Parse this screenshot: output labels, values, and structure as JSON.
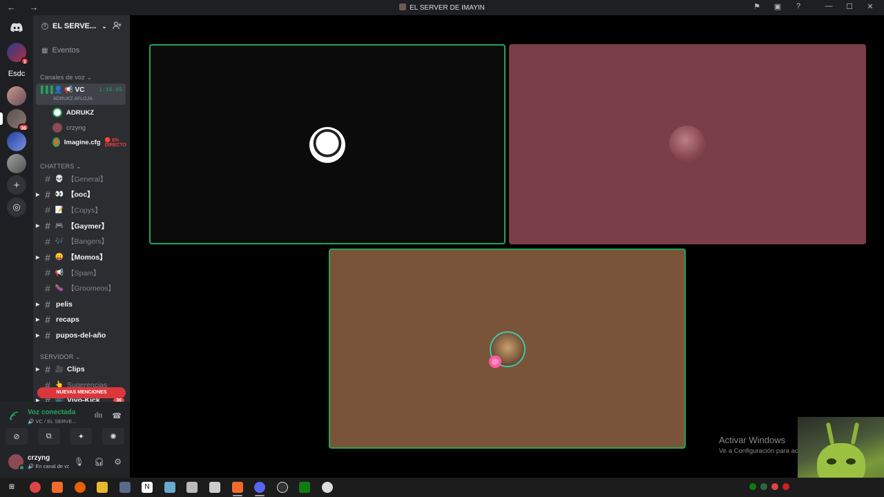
{
  "window": {
    "title": "EL SERVER DE IMAYIN",
    "nav_arrows": "← →",
    "icons": [
      "flag-icon",
      "inbox-icon",
      "help-icon",
      "minimize-icon",
      "maximize-icon",
      "close-icon"
    ],
    "icon_glyphs": [
      "⚑",
      "▣",
      "?",
      "—",
      "☐",
      "✕"
    ]
  },
  "guilds": {
    "home_icon": "discord-icon",
    "folder_label": "Esdc",
    "badges": [
      "1",
      "36"
    ],
    "add_glyph": "+",
    "discover_glyph": "◎"
  },
  "server": {
    "name": "EL SERVE...",
    "chevron": "⌄",
    "invite_glyph": "👤+",
    "events_label": "Eventos"
  },
  "voice_category": "Canales de voz",
  "voice_channel": {
    "name": "VC",
    "timer": "1:16:05",
    "status": "ADRUKZ AFLOJA",
    "members": [
      {
        "name": "ADRUKZ",
        "active": true,
        "color": "#ffffff"
      },
      {
        "name": "crzyng",
        "active": false,
        "color": "#8c4a52"
      },
      {
        "name": "Imagine.cfg",
        "active": true,
        "color": "#d86a2c",
        "live": "🔴 EN DIRECTO"
      }
    ]
  },
  "chatters_category": "CHATTERS",
  "chatters": [
    {
      "emoji": "💀",
      "name": "【General】",
      "unread": false,
      "arrow": false
    },
    {
      "emoji": "👀",
      "name": "【ooc】",
      "unread": true,
      "arrow": true
    },
    {
      "emoji": "📝",
      "name": "【Copys】",
      "unread": false,
      "arrow": false
    },
    {
      "emoji": "🎮",
      "name": "【Gaymer】",
      "unread": true,
      "arrow": true
    },
    {
      "emoji": "🎶",
      "name": "【Bangers】",
      "unread": false,
      "arrow": false
    },
    {
      "emoji": "😛",
      "name": "【Momos】",
      "unread": true,
      "arrow": true
    },
    {
      "emoji": "📢",
      "name": "【Spam】",
      "unread": false,
      "arrow": false
    },
    {
      "emoji": "🍆",
      "name": "【Groomeos】",
      "unread": false,
      "arrow": false
    },
    {
      "emoji": "",
      "name": "pelis",
      "unread": true,
      "arrow": true
    },
    {
      "emoji": "",
      "name": "recaps",
      "unread": true,
      "arrow": true
    },
    {
      "emoji": "",
      "name": "pupos-del-año",
      "unread": true,
      "arrow": true
    }
  ],
  "server_category": "SERVIDOR",
  "server_channels": [
    {
      "emoji": "🎥",
      "name": "Clips",
      "unread": true,
      "arrow": true
    },
    {
      "emoji": "👆",
      "name": "Sugerencias",
      "unread": false,
      "arrow": false
    },
    {
      "emoji": "📺",
      "name": "Vivo-Kick",
      "unread": true,
      "arrow": true,
      "badge": "36"
    }
  ],
  "new_mentions": "NUEVAS MENCIONES",
  "voice_panel": {
    "status": "Voz conectada",
    "location": "🔊 VC / EL SERVE...",
    "action_glyphs": [
      "⊘",
      "⧉",
      "✦",
      "✺"
    ]
  },
  "user": {
    "name": "crzyng",
    "status": "🔊 En canal de voz"
  },
  "tiles": [
    {
      "name": "ADRUKZ",
      "bg": "#0b0b0b",
      "speaking": true
    },
    {
      "name": "crzyng",
      "bg": "#7a3e48",
      "speaking": false
    },
    {
      "name": "Imagine.cfg",
      "bg": "#7a5438",
      "speaking": true
    }
  ],
  "watermark": {
    "line1": "Activar Windows",
    "line2": "Ve a Configuración para activar Windows."
  }
}
